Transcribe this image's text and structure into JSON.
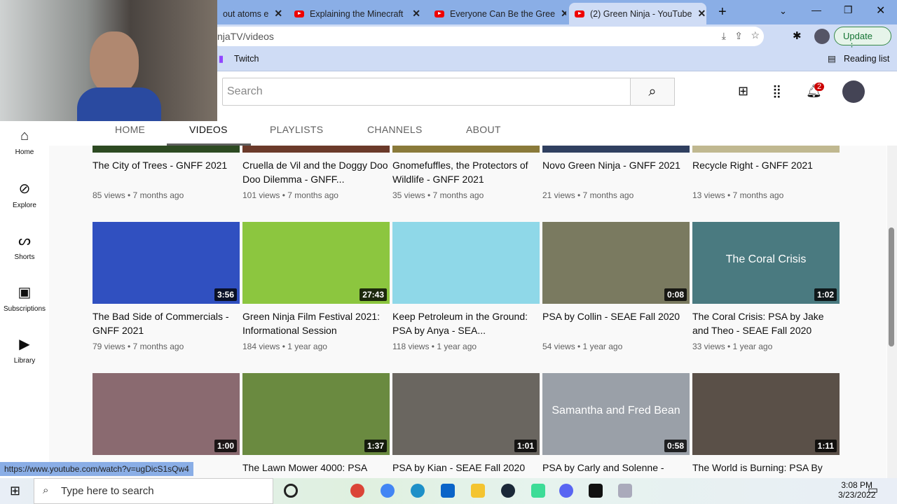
{
  "browser": {
    "tabs": [
      {
        "label": "out atoms e"
      },
      {
        "label": "Explaining the Minecraft"
      },
      {
        "label": "Everyone Can Be the Gree"
      },
      {
        "label": "(2) Green Ninja - YouTube",
        "active": true
      }
    ],
    "url": "njaTV/videos",
    "update_label": "Update",
    "bookmark": "Twitch",
    "reading_list": "Reading list",
    "status_url": "https://www.youtube.com/watch?v=ugDicS1sQw4"
  },
  "youtube": {
    "search_placeholder": "Search",
    "notification_count": "2",
    "sidebar": [
      {
        "label": "Home",
        "icon": "home-icon"
      },
      {
        "label": "Explore",
        "icon": "compass-icon"
      },
      {
        "label": "Shorts",
        "icon": "shorts-icon"
      },
      {
        "label": "Subscriptions",
        "icon": "subscriptions-icon"
      },
      {
        "label": "Library",
        "icon": "library-icon"
      }
    ],
    "channel_tabs": [
      {
        "label": "HOME"
      },
      {
        "label": "VIDEOS",
        "active": true
      },
      {
        "label": "PLAYLISTS"
      },
      {
        "label": "CHANNELS"
      },
      {
        "label": "ABOUT"
      }
    ],
    "videos": [
      {
        "title": "The City of Trees - GNFF 2021",
        "meta": "85 views • 7 months ago",
        "color": "#2d4a22"
      },
      {
        "title": "Cruella de Vil and the Doggy Doo Doo Dilemma - GNFF...",
        "meta": "101 views • 7 months ago",
        "color": "#6b3a2a"
      },
      {
        "title": "Gnomefuffles, the Protectors of Wildlife - GNFF 2021",
        "meta": "35 views • 7 months ago",
        "color": "#8a7a3a"
      },
      {
        "title": "Novo Green Ninja - GNFF 2021",
        "meta": "21 views • 7 months ago",
        "color": "#304060"
      },
      {
        "title": "Recycle Right - GNFF 2021",
        "meta": "13 views • 7 months ago",
        "color": "#c0b890"
      },
      {
        "title": "The Bad Side of Commercials - GNFF 2021",
        "meta": "79 views • 7 months ago",
        "duration": "3:56",
        "color": "#3050c0"
      },
      {
        "title": "Green Ninja Film Festival 2021: Informational Session",
        "meta": "184 views • 1 year ago",
        "duration": "27:43",
        "color": "#8cc63f"
      },
      {
        "title": "Keep Petroleum in the Ground: PSA by Anya - SEA...",
        "meta": "118 views • 1 year ago",
        "duration": "",
        "color": "#8fd8e8"
      },
      {
        "title": "PSA by Collin - SEAE Fall 2020",
        "meta": "54 views • 1 year ago",
        "duration": "0:08",
        "color": "#7a7a60"
      },
      {
        "title": "The Coral Crisis: PSA by Jake and Theo - SEAE Fall 2020",
        "meta": "33 views • 1 year ago",
        "duration": "1:02",
        "color": "#4a7a80",
        "overlay": "The Coral Crisis"
      },
      {
        "title": "ll 2020",
        "meta": "",
        "duration": "1:00",
        "color": "#8a6a70"
      },
      {
        "title": "The Lawn Mower 4000: PSA",
        "meta": "",
        "duration": "1:37",
        "color": "#6a8a40"
      },
      {
        "title": "PSA by Kian - SEAE Fall 2020",
        "meta": "",
        "duration": "1:01",
        "color": "#6a6660"
      },
      {
        "title": "PSA by Carly and Solenne -",
        "meta": "",
        "duration": "0:58",
        "color": "#9aa0a8",
        "overlay": "Samantha and Fred Bean"
      },
      {
        "title": "The World is Burning: PSA By",
        "meta": "",
        "duration": "1:11",
        "color": "#5a5048"
      }
    ]
  },
  "taskbar": {
    "search_placeholder": "Type here to search",
    "time": "3:08 PM",
    "date": "3/23/2022"
  }
}
